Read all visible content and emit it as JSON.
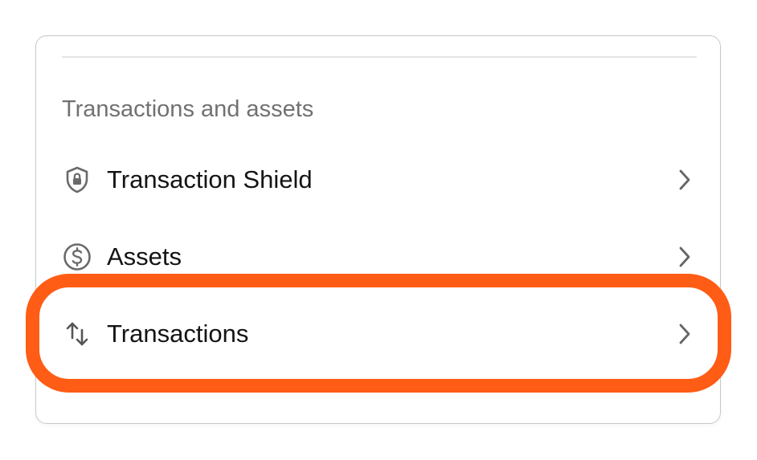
{
  "section": {
    "title": "Transactions and assets"
  },
  "items": [
    {
      "label": "Transaction Shield",
      "icon": "shield-lock-icon"
    },
    {
      "label": "Assets",
      "icon": "dollar-circle-icon"
    },
    {
      "label": "Transactions",
      "icon": "arrows-up-down-icon"
    }
  ],
  "colors": {
    "highlight": "#ff5c16",
    "label": "#141414",
    "section_title": "#717171",
    "icon": "#6a6a6a"
  }
}
